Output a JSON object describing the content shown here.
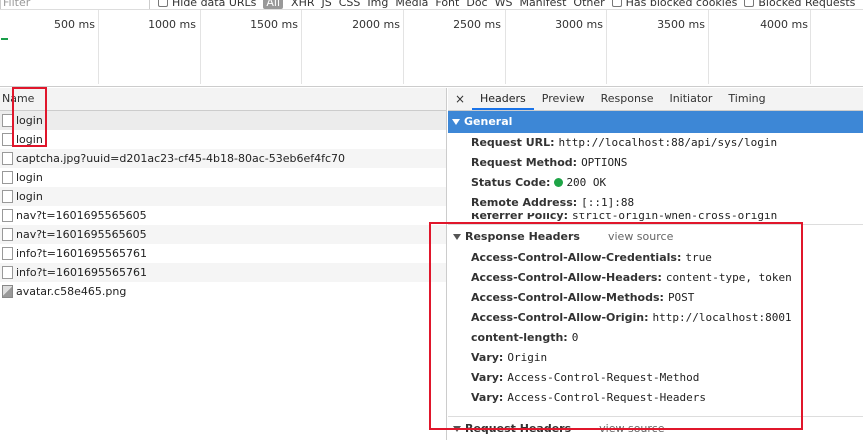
{
  "filterbar": {
    "filter_placeholder": "Filter",
    "hide_data_urls": "Hide data URLs",
    "all": "All",
    "types": [
      "XHR",
      "JS",
      "CSS",
      "Img",
      "Media",
      "Font",
      "Doc",
      "WS",
      "Manifest",
      "Other"
    ],
    "has_blocked_cookies": "Has blocked cookies",
    "blocked_requests": "Blocked Requests"
  },
  "timeline": {
    "ticks": [
      "500 ms",
      "1000 ms",
      "1500 ms",
      "2000 ms",
      "2500 ms",
      "3000 ms",
      "3500 ms",
      "4000 ms"
    ]
  },
  "requests": {
    "header": "Name",
    "rows": [
      "login",
      "login",
      "captcha.jpg?uuid=d201ac23-cf45-4b18-80ac-53eb6ef4fc70",
      "login",
      "login",
      "nav?t=1601695565605",
      "nav?t=1601695565605",
      "info?t=1601695565761",
      "info?t=1601695565761",
      "avatar.c58e465.png"
    ]
  },
  "details": {
    "close": "×",
    "tabs": [
      "Headers",
      "Preview",
      "Response",
      "Initiator",
      "Timing"
    ],
    "general": {
      "title": "General",
      "request_url_key": "Request URL:",
      "request_url": "http://localhost:88/api/sys/login",
      "method_key": "Request Method:",
      "method": "OPTIONS",
      "status_key": "Status Code:",
      "status": "200 OK",
      "remote_key": "Remote Address:",
      "remote": "[::1]:88",
      "referrer_key": "Referrer Policy:",
      "referrer": "strict-origin-when-cross-origin"
    },
    "response_headers": {
      "title": "Response Headers",
      "view_source": "view source",
      "items": [
        {
          "k": "Access-Control-Allow-Credentials:",
          "v": "true"
        },
        {
          "k": "Access-Control-Allow-Headers:",
          "v": "content-type, token"
        },
        {
          "k": "Access-Control-Allow-Methods:",
          "v": "POST"
        },
        {
          "k": "Access-Control-Allow-Origin:",
          "v": "http://localhost:8001"
        },
        {
          "k": "content-length:",
          "v": "0"
        },
        {
          "k": "Vary:",
          "v": "Origin"
        },
        {
          "k": "Vary:",
          "v": "Access-Control-Request-Method"
        },
        {
          "k": "Vary:",
          "v": "Access-Control-Request-Headers"
        }
      ]
    },
    "request_headers": {
      "title": "Request Headers",
      "view_source": "view source"
    }
  },
  "colors": {
    "accent": "#3d87d6",
    "annotation": "#e0162b",
    "status_ok": "#1ea446"
  }
}
